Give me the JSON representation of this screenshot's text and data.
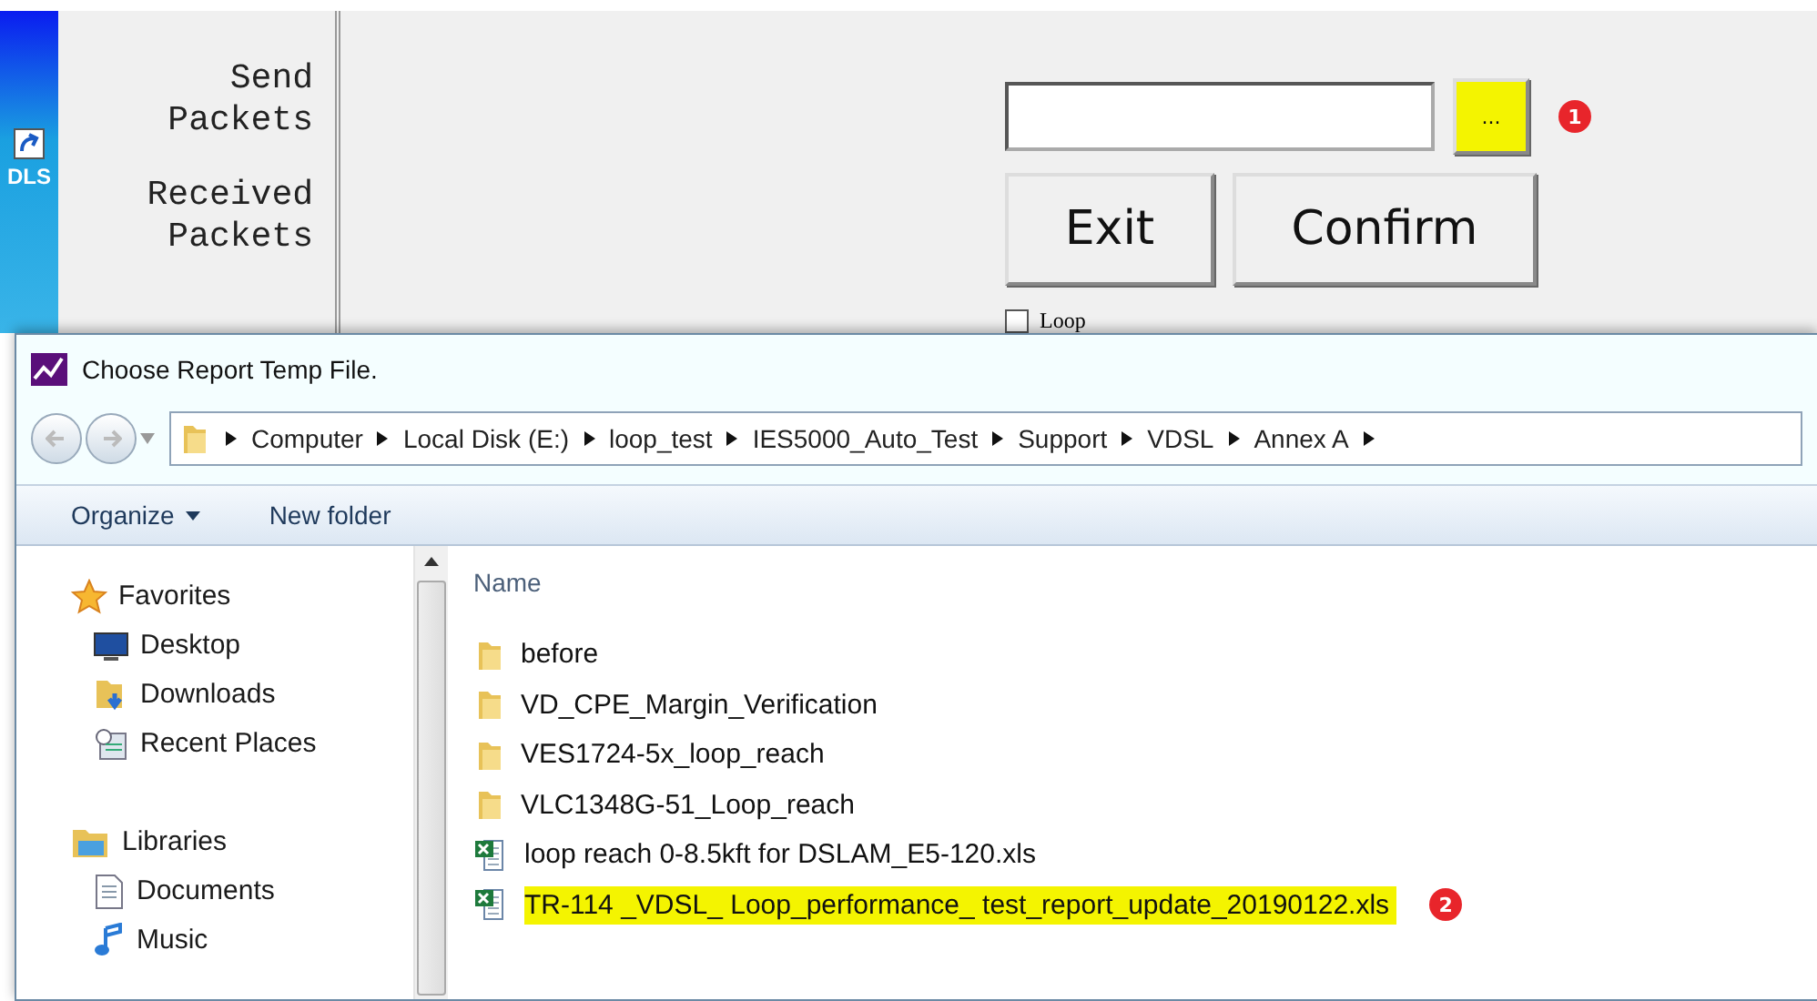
{
  "desktop": {
    "shortcut_label": "DLS"
  },
  "app": {
    "side_labels": [
      "Send Packets",
      "Received Packets"
    ],
    "browse_button": {
      "label": "...",
      "highlighted": true,
      "annotation": "1"
    },
    "buttons": [
      "Exit",
      "Confirm"
    ],
    "loop_option": {
      "label": "Loop",
      "checked": false
    }
  },
  "dialog": {
    "title": "Choose Report Temp File.",
    "breadcrumb": [
      "Computer",
      "Local Disk (E:)",
      "loop_test",
      "IES5000_Auto_Test",
      "Support",
      "VDSL",
      "Annex A"
    ],
    "toolbar": [
      {
        "label": "Organize",
        "dropdown": true
      },
      {
        "label": "New folder",
        "dropdown": false
      }
    ],
    "nav": [
      {
        "label": "Favorites",
        "kind": "favorites",
        "children": [
          {
            "label": "Desktop",
            "kind": "desktop"
          },
          {
            "label": "Downloads",
            "kind": "downloads"
          },
          {
            "label": "Recent Places",
            "kind": "recent"
          }
        ]
      },
      {
        "label": "Libraries",
        "kind": "libraries",
        "children": [
          {
            "label": "Documents",
            "kind": "documents"
          },
          {
            "label": "Music",
            "kind": "music"
          }
        ]
      }
    ],
    "column": "Name",
    "files": [
      {
        "name": "before",
        "kind": "folder",
        "highlighted": false
      },
      {
        "name": "VD_CPE_Margin_Verification",
        "kind": "folder",
        "highlighted": false
      },
      {
        "name": "VES1724-5x_loop_reach",
        "kind": "folder",
        "highlighted": false
      },
      {
        "name": "VLC1348G-51_Loop_reach",
        "kind": "folder",
        "highlighted": false
      },
      {
        "name": "loop reach 0-8.5kft for DSLAM_E5-120.xls",
        "kind": "excel",
        "highlighted": false
      },
      {
        "name": "TR-114 _VDSL_ Loop_performance_ test_report_update_20190122.xls",
        "kind": "excel",
        "highlighted": true,
        "annotation": "2"
      }
    ]
  }
}
